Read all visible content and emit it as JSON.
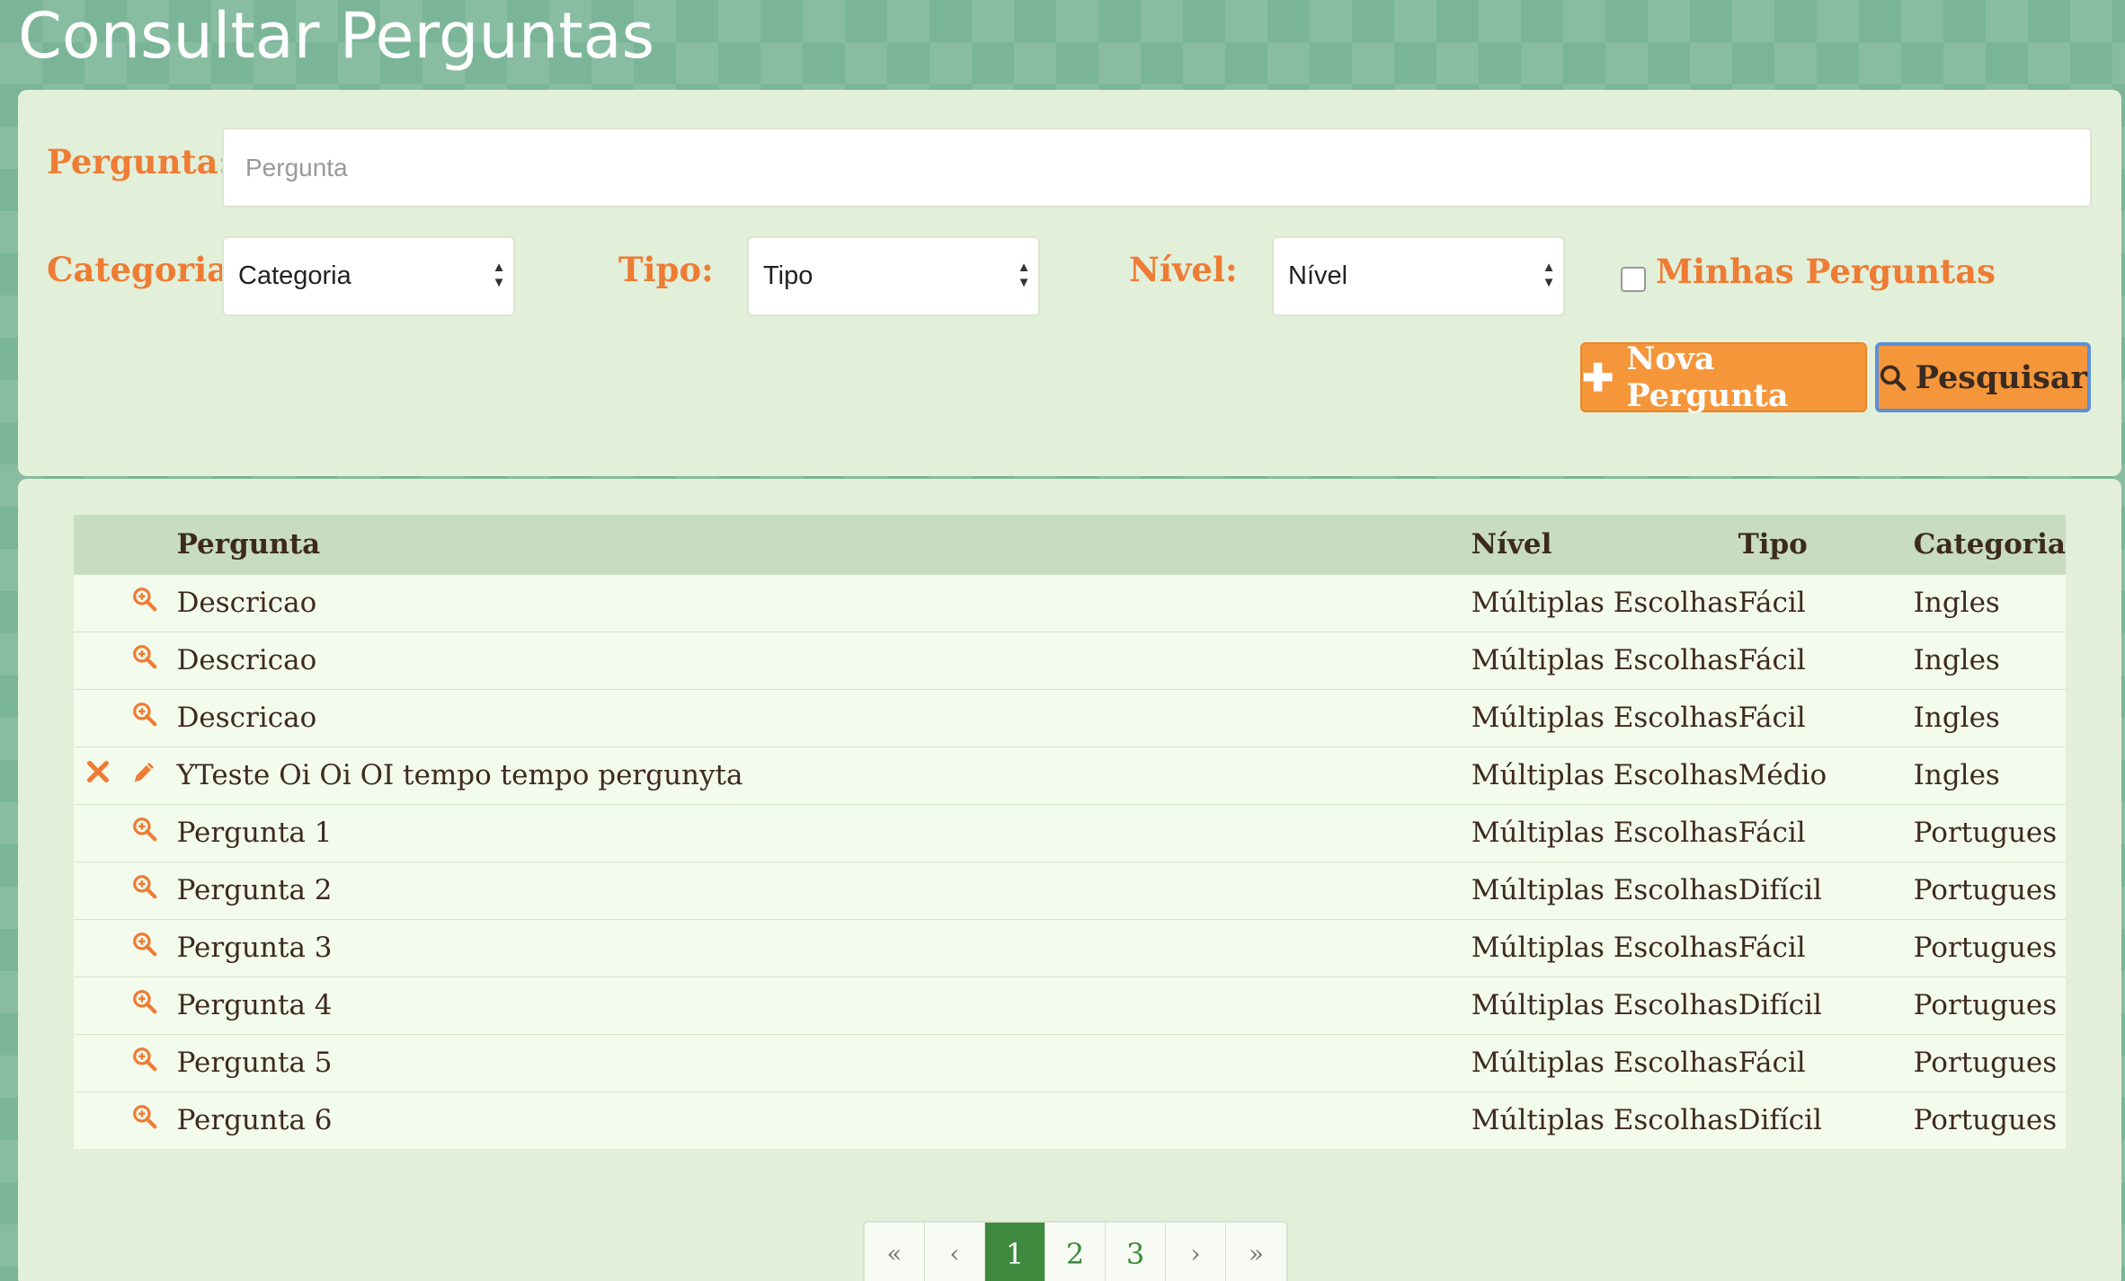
{
  "page": {
    "title": "Consultar Perguntas"
  },
  "filters": {
    "pergunta_label": "Pergunta:",
    "pergunta_placeholder": "Pergunta",
    "categoria_label": "Categoria:",
    "categoria_value": "Categoria",
    "tipo_label": "Tipo:",
    "tipo_value": "Tipo",
    "nivel_label": "Nível:",
    "nivel_value": "Nível",
    "minhas_label": "Minhas Perguntas",
    "minhas_checked": false
  },
  "buttons": {
    "nova_label": "Nova Pergunta",
    "pesquisar_label": "Pesquisar",
    "accent": "#f5963a"
  },
  "table": {
    "headers": {
      "pergunta": "Pergunta",
      "nivel": "Nível",
      "tipo": "Tipo",
      "categoria": "Categoria"
    },
    "rows": [
      {
        "icons": [
          "view-icon"
        ],
        "pergunta": "Descricao",
        "nivel": "Múltiplas Escolhas",
        "tipo": "Fácil",
        "categoria": "Ingles"
      },
      {
        "icons": [
          "view-icon"
        ],
        "pergunta": "Descricao",
        "nivel": "Múltiplas Escolhas",
        "tipo": "Fácil",
        "categoria": "Ingles"
      },
      {
        "icons": [
          "view-icon"
        ],
        "pergunta": "Descricao",
        "nivel": "Múltiplas Escolhas",
        "tipo": "Fácil",
        "categoria": "Ingles"
      },
      {
        "icons": [
          "delete-icon",
          "edit-icon"
        ],
        "pergunta": "YTeste Oi Oi OI tempo tempo pergunyta",
        "nivel": "Múltiplas Escolhas",
        "tipo": "Médio",
        "categoria": "Ingles"
      },
      {
        "icons": [
          "view-icon"
        ],
        "pergunta": "Pergunta 1",
        "nivel": "Múltiplas Escolhas",
        "tipo": "Fácil",
        "categoria": "Portugues"
      },
      {
        "icons": [
          "view-icon"
        ],
        "pergunta": "Pergunta 2",
        "nivel": "Múltiplas Escolhas",
        "tipo": "Difícil",
        "categoria": "Portugues"
      },
      {
        "icons": [
          "view-icon"
        ],
        "pergunta": "Pergunta 3",
        "nivel": "Múltiplas Escolhas",
        "tipo": "Fácil",
        "categoria": "Portugues"
      },
      {
        "icons": [
          "view-icon"
        ],
        "pergunta": "Pergunta 4",
        "nivel": "Múltiplas Escolhas",
        "tipo": "Difícil",
        "categoria": "Portugues"
      },
      {
        "icons": [
          "view-icon"
        ],
        "pergunta": "Pergunta 5",
        "nivel": "Múltiplas Escolhas",
        "tipo": "Fácil",
        "categoria": "Portugues"
      },
      {
        "icons": [
          "view-icon"
        ],
        "pergunta": "Pergunta 6",
        "nivel": "Múltiplas Escolhas",
        "tipo": "Difícil",
        "categoria": "Portugues"
      }
    ]
  },
  "pagination": {
    "first": "«",
    "prev": "‹",
    "pages": [
      "1",
      "2",
      "3"
    ],
    "current": "1",
    "next": "›",
    "last": "»"
  }
}
